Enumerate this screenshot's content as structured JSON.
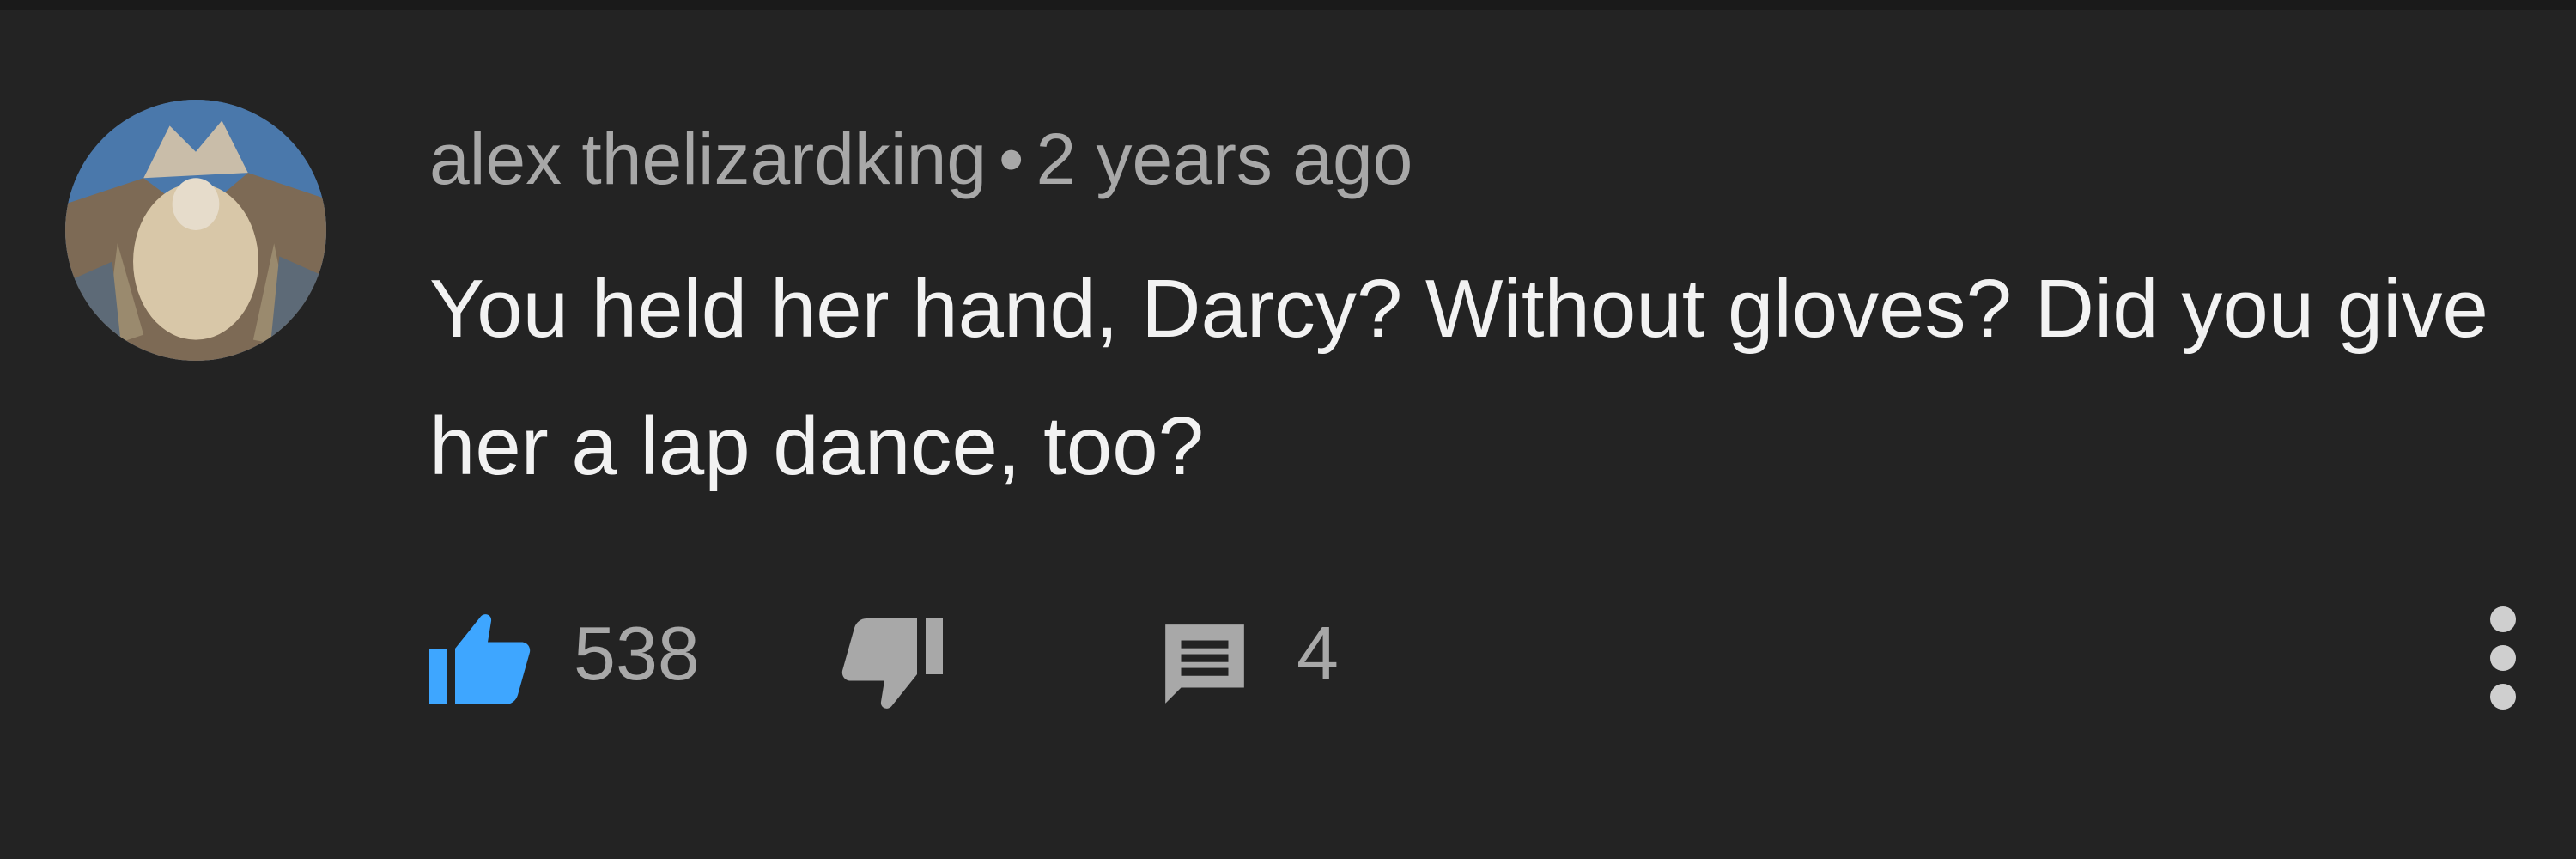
{
  "comment": {
    "author": "alex thelizardking",
    "separator": "•",
    "time": "2 years ago",
    "text": "You held her hand, Darcy? Without gloves? Did you give her a lap dance, too?",
    "likes": "538",
    "replies": "4",
    "like_state": "liked"
  },
  "colors": {
    "background": "#232323",
    "like_active": "#3ea6ff",
    "meta_text": "#a8a8a8",
    "body_text": "#f2f2f2"
  },
  "icons": {
    "like": "thumbs-up-icon",
    "dislike": "thumbs-down-icon",
    "reply": "comment-icon",
    "more": "more-vert-icon"
  }
}
